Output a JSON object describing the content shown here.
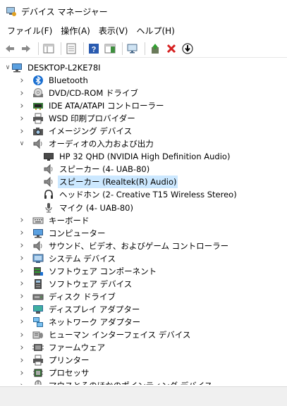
{
  "window": {
    "title": "デバイス マネージャー"
  },
  "menu": [
    "ファイル(F)",
    "操作(A)",
    "表示(V)",
    "ヘルプ(H)"
  ],
  "tree": {
    "root": "DESKTOP-L2KE78I",
    "items": [
      {
        "label": "Bluetooth",
        "icon": "bluetooth-icon"
      },
      {
        "label": "DVD/CD-ROM ドライブ",
        "icon": "dvd-drive-icon"
      },
      {
        "label": "IDE ATA/ATAPI コントローラー",
        "icon": "ide-controller-icon"
      },
      {
        "label": "WSD 印刷プロバイダー",
        "icon": "printer-icon"
      },
      {
        "label": "イメージング デバイス",
        "icon": "camera-icon"
      },
      {
        "label": "オーディオの入力および出力",
        "icon": "speaker-icon",
        "expanded": true
      },
      {
        "label": "HP 32 QHD (NVIDIA High Definition Audio)",
        "icon": "monitor-icon",
        "child": true
      },
      {
        "label": "スピーカー (4- UAB-80)",
        "icon": "speaker-icon",
        "child": true
      },
      {
        "label": "スピーカー (Realtek(R) Audio)",
        "icon": "speaker-icon",
        "child": true,
        "selected": true
      },
      {
        "label": "ヘッドホン (2- Creative T15 Wireless Stereo)",
        "icon": "headphones-icon",
        "child": true
      },
      {
        "label": "マイク (4- UAB-80)",
        "icon": "microphone-icon",
        "child": true
      },
      {
        "label": "キーボード",
        "icon": "keyboard-icon"
      },
      {
        "label": "コンピューター",
        "icon": "computer-icon"
      },
      {
        "label": "サウンド、ビデオ、およびゲーム コントローラー",
        "icon": "speaker-icon"
      },
      {
        "label": "システム デバイス",
        "icon": "system-device-icon"
      },
      {
        "label": "ソフトウェア コンポーネント",
        "icon": "software-component-icon"
      },
      {
        "label": "ソフトウェア デバイス",
        "icon": "software-device-icon"
      },
      {
        "label": "ディスク ドライブ",
        "icon": "disk-drive-icon"
      },
      {
        "label": "ディスプレイ アダプター",
        "icon": "display-adapter-icon"
      },
      {
        "label": "ネットワーク アダプター",
        "icon": "network-adapter-icon"
      },
      {
        "label": "ヒューマン インターフェイス デバイス",
        "icon": "hid-icon"
      },
      {
        "label": "ファームウェア",
        "icon": "firmware-icon"
      },
      {
        "label": "プリンター",
        "icon": "printer-icon"
      },
      {
        "label": "プロセッサ",
        "icon": "processor-icon"
      },
      {
        "label": "マウスとそのほかのポインティング デバイス",
        "icon": "mouse-icon"
      }
    ]
  }
}
